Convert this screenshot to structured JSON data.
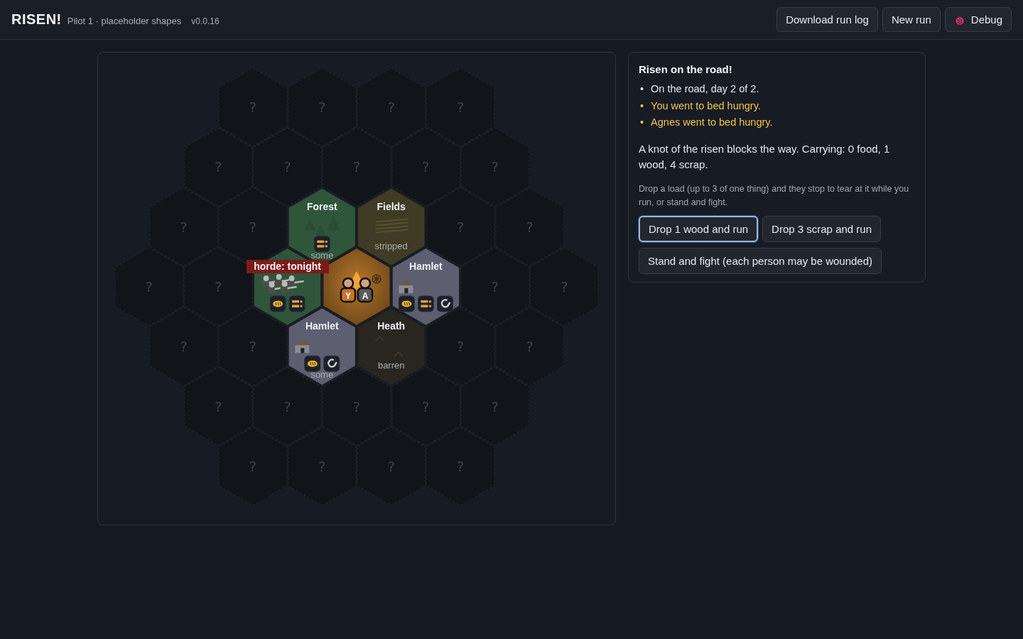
{
  "header": {
    "title": "RISEN!",
    "subtitle": "Pilot 1 · placeholder shapes",
    "version": "v0.0.16",
    "buttons": [
      {
        "label": "Download run log",
        "kind": "plain"
      },
      {
        "label": "New run",
        "kind": "plain"
      },
      {
        "label": "Debug",
        "kind": "debug"
      }
    ]
  },
  "board": {
    "rows": [
      [
        {
          "kind": "unknown",
          "text": "?"
        },
        {
          "kind": "unknown",
          "text": "?"
        },
        {
          "kind": "unknown",
          "text": "?"
        },
        {
          "kind": "unknown",
          "text": "?"
        }
      ],
      [
        {
          "kind": "unknown",
          "text": "?"
        },
        {
          "kind": "unknown",
          "text": "?"
        },
        {
          "kind": "unknown",
          "text": "?"
        },
        {
          "kind": "unknown",
          "text": "?"
        },
        {
          "kind": "unknown",
          "text": "?"
        }
      ],
      [
        {
          "kind": "unknown",
          "text": "?"
        },
        {
          "kind": "unknown",
          "text": "?"
        },
        {
          "kind": "forest",
          "name": "Forest",
          "resources": [
            {
              "kind": "scrap"
            }
          ],
          "note": "some"
        },
        {
          "kind": "fields",
          "name": "Fields",
          "note": "stripped"
        },
        {
          "kind": "unknown",
          "text": "?"
        },
        {
          "kind": "unknown",
          "text": "?"
        }
      ],
      [
        {
          "kind": "unknown",
          "text": "?"
        },
        {
          "kind": "unknown",
          "text": "?"
        },
        {
          "kind": "forest",
          "resources": [
            {
              "kind": "food"
            },
            {
              "kind": "scrap"
            }
          ],
          "horde": "horde: tonight"
        },
        {
          "kind": "camp",
          "party": [
            {
              "initial": "Y",
              "color": "#c8742a"
            },
            {
              "initial": "A",
              "color": "#5c5a58"
            }
          ]
        },
        {
          "kind": "hamlet",
          "name": "Hamlet",
          "resources": [
            {
              "kind": "food"
            },
            {
              "kind": "scrap"
            },
            {
              "kind": "tool"
            }
          ]
        },
        {
          "kind": "unknown",
          "text": "?"
        },
        {
          "kind": "unknown",
          "text": "?"
        }
      ],
      [
        {
          "kind": "unknown",
          "text": "?"
        },
        {
          "kind": "unknown",
          "text": "?"
        },
        {
          "kind": "hamlet",
          "name": "Hamlet",
          "resources": [
            {
              "kind": "food"
            },
            {
              "kind": "tool"
            }
          ],
          "note": "some"
        },
        {
          "kind": "heath",
          "name": "Heath",
          "note": "barren"
        },
        {
          "kind": "unknown",
          "text": "?"
        },
        {
          "kind": "unknown",
          "text": "?"
        }
      ],
      [
        {
          "kind": "unknown",
          "text": "?"
        },
        {
          "kind": "unknown",
          "text": "?"
        },
        {
          "kind": "unknown",
          "text": "?"
        },
        {
          "kind": "unknown",
          "text": "?"
        },
        {
          "kind": "unknown",
          "text": "?"
        }
      ],
      [
        {
          "kind": "unknown",
          "text": "?"
        },
        {
          "kind": "unknown",
          "text": "?"
        },
        {
          "kind": "unknown",
          "text": "?"
        },
        {
          "kind": "unknown",
          "text": "?"
        }
      ]
    ]
  },
  "event": {
    "title": "Risen on the road!",
    "log": [
      {
        "marker": "•",
        "text": "On the road, day 2 of 2.",
        "kind": "info"
      },
      {
        "marker": "•",
        "text": "You went to bed hungry.",
        "kind": "warning"
      },
      {
        "marker": "•",
        "text": "Agnes went to bed hungry.",
        "kind": "warning"
      }
    ],
    "description": "A knot of the risen blocks the way. Carrying: 0 food, 1 wood, 4 scrap.",
    "hint": "Drop a load (up to 3 of one thing) and they stop to tear at it while you run, or stand and fight.",
    "choices": [
      {
        "label": "Drop 1 wood and run",
        "selected": true
      },
      {
        "label": "Drop 3 scrap and run",
        "selected": false
      },
      {
        "label": "Stand and fight (each person may be wounded)",
        "selected": false
      }
    ]
  }
}
